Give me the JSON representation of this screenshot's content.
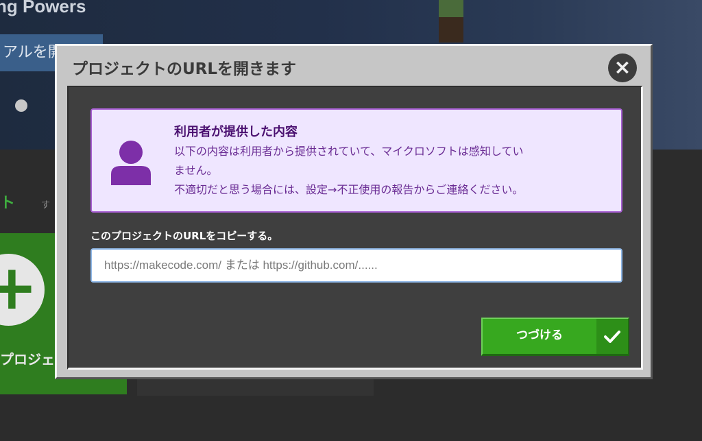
{
  "background": {
    "hero_title": "ng Powers",
    "hero_button": "アルを開",
    "section_title": "ト",
    "section_sub": "す",
    "new_project_label": "プロジェク"
  },
  "modal": {
    "title": "プロジェクトのURLを開きます",
    "close_icon": "×",
    "notice": {
      "title": "利用者が提供した内容",
      "line1": "以下の内容は利用者から提供されていて、マイクロソフトは感知してい",
      "line2": "ません。",
      "line3": "不適切だと思う場合には、設定→不正使用の報告からご連絡ください。"
    },
    "url_label": "このプロジェクトのURLをコピーする。",
    "url_input": {
      "value": "",
      "placeholder": "https://makecode.com/ または https://github.com/......"
    },
    "go_button_label": "つづける"
  },
  "colors": {
    "accent_green": "#37a81f",
    "notice_bg": "#efe6ff",
    "notice_text": "#6a2c94",
    "notice_border": "#a85fd4"
  }
}
